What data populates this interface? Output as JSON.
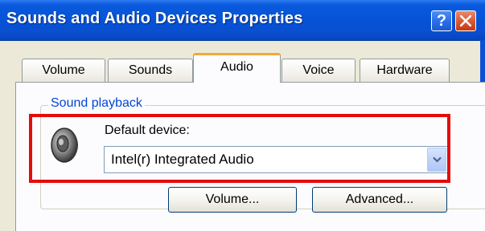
{
  "window": {
    "title": "Sounds and Audio Devices Properties"
  },
  "titlebar_buttons": {
    "help_label": "?"
  },
  "tabs": [
    {
      "label": "Volume"
    },
    {
      "label": "Sounds"
    },
    {
      "label": "Audio"
    },
    {
      "label": "Voice"
    },
    {
      "label": "Hardware"
    }
  ],
  "active_tab": "Audio",
  "sound_playback": {
    "group_label": "Sound playback",
    "default_device_label": "Default device:",
    "selected_device": "Intel(r) Integrated Audio",
    "volume_button": "Volume...",
    "advanced_button": "Advanced..."
  },
  "colors": {
    "titlebar": "#0552d6",
    "highlight": "#e50b0b",
    "group_label": "#0046d5",
    "active_tab_accent": "#f2a83a"
  },
  "icons": {
    "speaker": "speaker-icon",
    "close": "close-icon",
    "help": "help-icon",
    "dropdown": "chevron-down-icon"
  }
}
